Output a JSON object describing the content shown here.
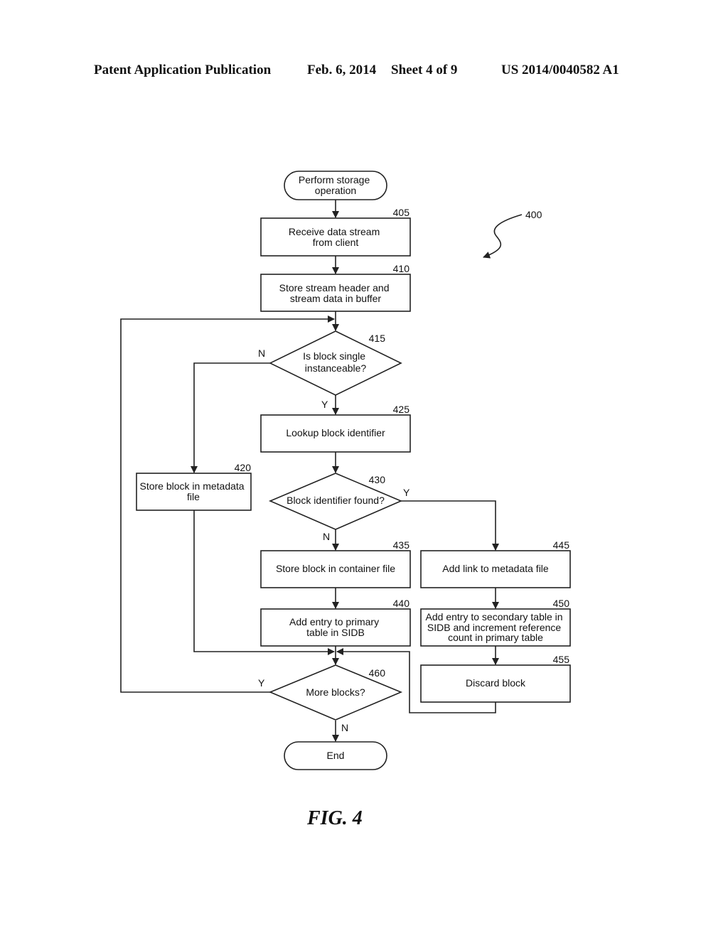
{
  "header": {
    "publication": "Patent Application Publication",
    "date": "Feb. 6, 2014",
    "sheet": "Sheet 4 of 9",
    "number": "US 2014/0040582 A1"
  },
  "figure": {
    "ref": "400",
    "caption": "FIG. 4"
  },
  "nodes": {
    "start": {
      "lines": [
        "Perform storage",
        "operation"
      ]
    },
    "n405": {
      "ref": "405",
      "lines": [
        "Receive data stream",
        "from client"
      ]
    },
    "n410": {
      "ref": "410",
      "lines": [
        "Store stream header and",
        "stream data in buffer"
      ]
    },
    "n415": {
      "ref": "415",
      "lines": [
        "Is block single",
        "instanceable?"
      ]
    },
    "n420": {
      "ref": "420",
      "lines": [
        "Store block in metadata",
        "file"
      ]
    },
    "n425": {
      "ref": "425",
      "lines": [
        "Lookup block identifier"
      ]
    },
    "n430": {
      "ref": "430",
      "lines": [
        "Block identifier found?"
      ]
    },
    "n435": {
      "ref": "435",
      "lines": [
        "Store block in container file"
      ]
    },
    "n440": {
      "ref": "440",
      "lines": [
        "Add entry to primary",
        "table in SIDB"
      ]
    },
    "n445": {
      "ref": "445",
      "lines": [
        "Add link to metadata file"
      ]
    },
    "n450": {
      "ref": "450",
      "lines": [
        "Add entry to secondary table in",
        "SIDB and increment reference",
        "count in primary table"
      ]
    },
    "n455": {
      "ref": "455",
      "lines": [
        "Discard block"
      ]
    },
    "n460": {
      "ref": "460",
      "lines": [
        "More blocks?"
      ]
    },
    "end": {
      "lines": [
        "End"
      ]
    }
  },
  "edge_labels": {
    "n415_no": "N",
    "n415_yes": "Y",
    "n430_yes": "Y",
    "n430_no": "N",
    "n460_yes": "Y",
    "n460_no": "N"
  }
}
